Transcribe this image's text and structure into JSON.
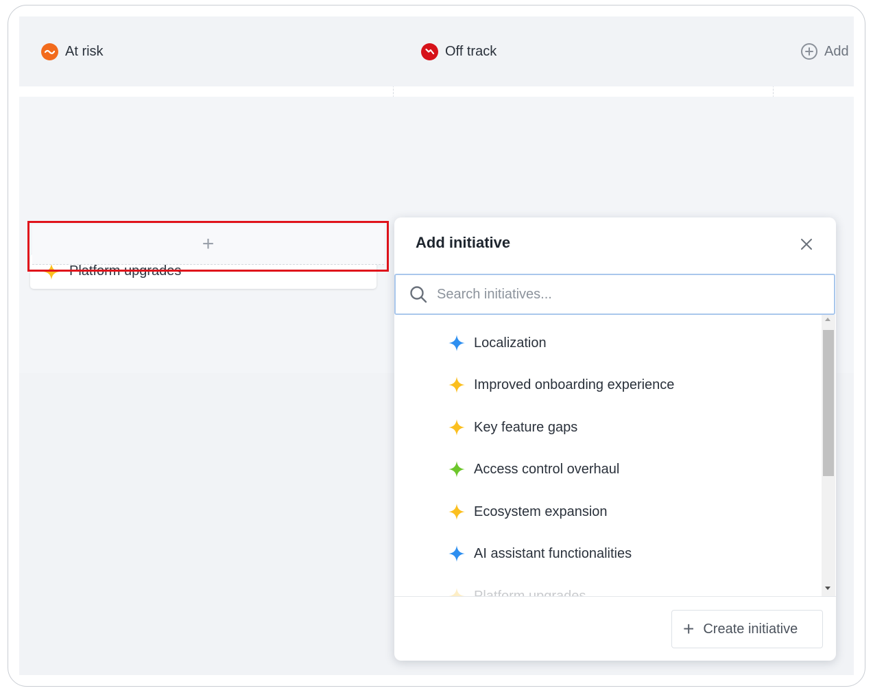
{
  "board": {
    "columns": [
      {
        "title": "At risk",
        "icon": "at-risk-status-icon",
        "color": "#f26b1d"
      },
      {
        "title": "Off track",
        "icon": "off-track-status-icon",
        "color": "#d6121a"
      },
      {
        "title": "Add",
        "icon": "plus-circle-icon"
      }
    ],
    "cards": [
      {
        "title": "Platform upgrades",
        "icon": "sparkle-icon",
        "color": "#fbbf1f"
      }
    ],
    "add_card_symbol": "+"
  },
  "popover": {
    "title": "Add initiative",
    "close_symbol": "×",
    "search_placeholder": "Search initiatives...",
    "items": [
      {
        "label": "Localization",
        "color": "#2e8ff0"
      },
      {
        "label": "Improved onboarding experience",
        "color": "#fbbf1f"
      },
      {
        "label": "Key feature gaps",
        "color": "#fbbf1f"
      },
      {
        "label": "Access control overhaul",
        "color": "#6dc62b"
      },
      {
        "label": "Ecosystem expansion",
        "color": "#fbbf1f"
      },
      {
        "label": "AI assistant functionalities",
        "color": "#2e8ff0"
      },
      {
        "label": "Platform upgrades",
        "color": "#fbbf1f"
      }
    ],
    "create_label": "Create initiative",
    "create_symbol": "+"
  },
  "colors": {
    "highlight": "#e0131b",
    "search_focus": "#a9c7ec"
  }
}
